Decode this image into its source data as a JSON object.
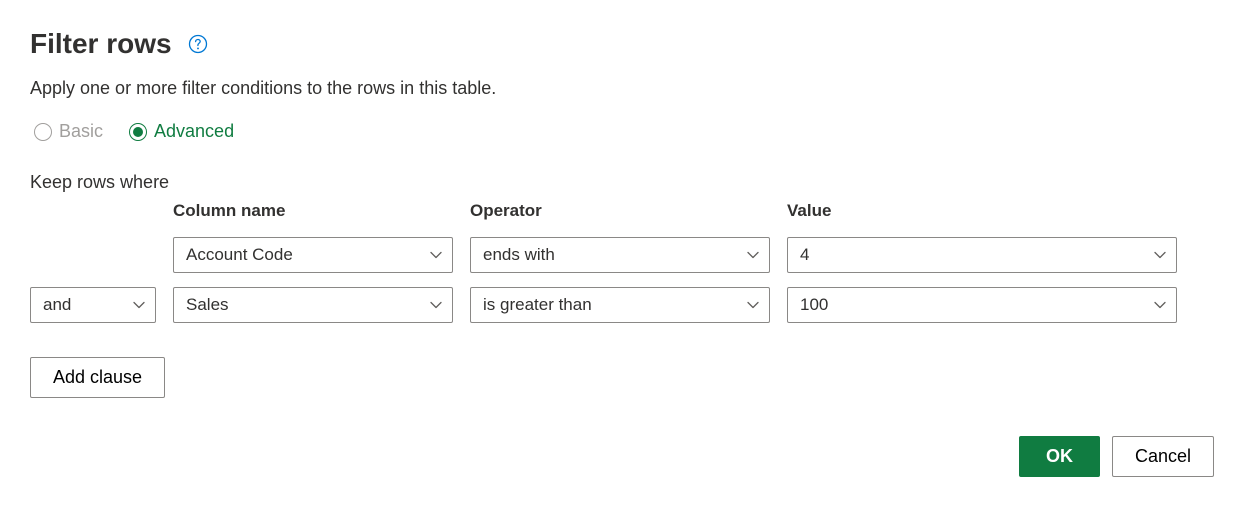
{
  "header": {
    "title": "Filter rows",
    "subtitle": "Apply one or more filter conditions to the rows in this table."
  },
  "mode": {
    "basic_label": "Basic",
    "advanced_label": "Advanced",
    "selected": "advanced"
  },
  "keep_label": "Keep rows where",
  "columns": {
    "column_name": "Column name",
    "operator": "Operator",
    "value": "Value"
  },
  "clauses": [
    {
      "logic": "",
      "column": "Account Code",
      "operator": "ends with",
      "value": "4"
    },
    {
      "logic": "and",
      "column": "Sales",
      "operator": "is greater than",
      "value": "100"
    }
  ],
  "add_clause_label": "Add clause",
  "buttons": {
    "ok": "OK",
    "cancel": "Cancel"
  },
  "colors": {
    "accent": "#107c41",
    "link": "#0078d4"
  }
}
